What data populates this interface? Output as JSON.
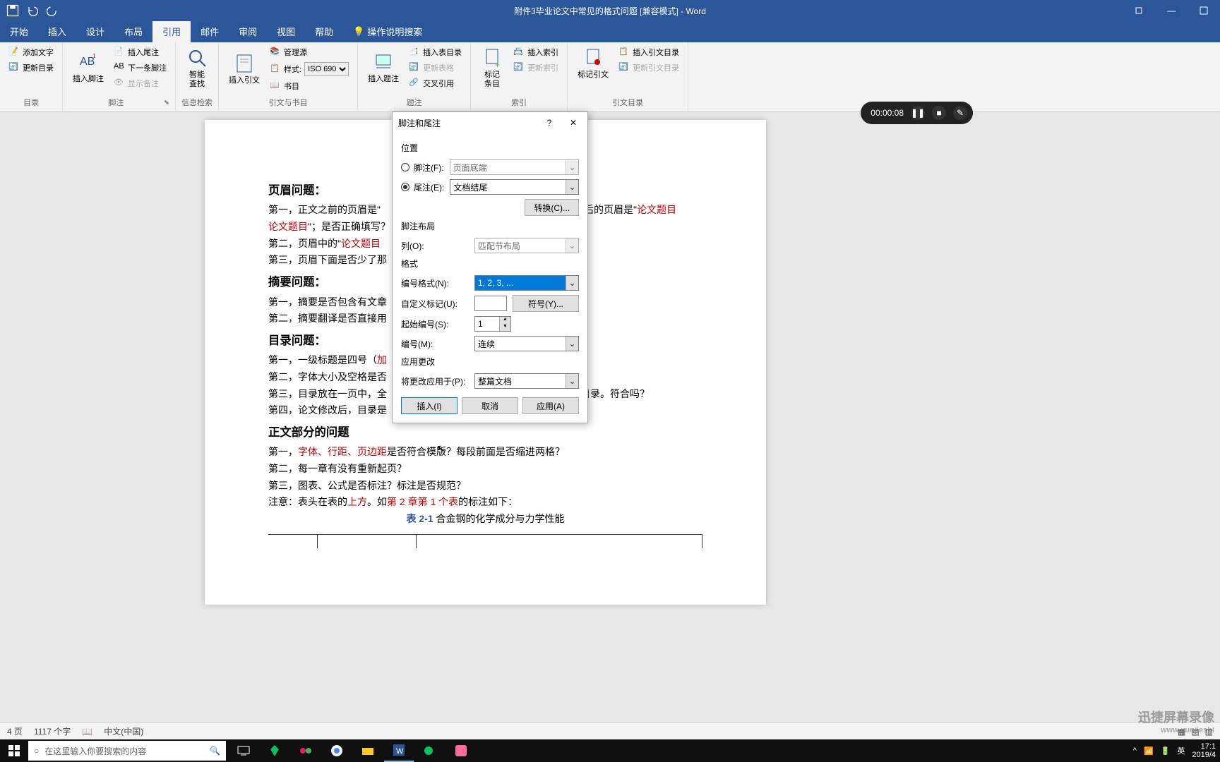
{
  "titlebar": {
    "title": "附件3毕业论文中常见的格式问题 [兼容模式] - Word"
  },
  "tabs": {
    "start": "开始",
    "insert": "插入",
    "design": "设计",
    "layout": "布局",
    "references": "引用",
    "mailings": "邮件",
    "review": "审阅",
    "view": "视图",
    "help": "帮助",
    "search": "操作说明搜索"
  },
  "ribbon": {
    "toc": {
      "add_text": "添加文字",
      "update_toc": "更新目录",
      "label": "目录"
    },
    "footnotes": {
      "insert_footnote": "插入脚注",
      "insert_endnote": "插入尾注",
      "next_footnote": "下一条脚注",
      "show_notes": "显示备注",
      "label": "脚注"
    },
    "research": {
      "smart_lookup": "智能\n查找",
      "label": "信息检索"
    },
    "citations": {
      "insert_citation": "插入引文",
      "manage_sources": "管理源",
      "style": "样式:",
      "style_value": "ISO 690",
      "bibliography": "书目",
      "label": "引文与书目"
    },
    "captions": {
      "insert_caption": "插入题注",
      "insert_tof": "插入表目录",
      "update_table": "更新表格",
      "cross_ref": "交叉引用",
      "label": "题注"
    },
    "index": {
      "mark_entry": "标记\n条目",
      "insert_index": "插入索引",
      "update_index": "更新索引",
      "label": "索引"
    },
    "toa": {
      "mark_citation": "标记引文",
      "insert_toa": "插入引文目录",
      "update_toa": "更新引文目录",
      "label": "引文目录"
    }
  },
  "dialog": {
    "title": "脚注和尾注",
    "sec_location": "位置",
    "footnote": "脚注(F):",
    "footnote_pos": "页面底端",
    "endnote": "尾注(E):",
    "endnote_pos": "文档结尾",
    "convert": "转换(C)...",
    "sec_layout": "脚注布局",
    "columns": "列(O):",
    "columns_val": "匹配节布局",
    "sec_format": "格式",
    "number_format": "编号格式(N):",
    "number_format_val": "1, 2, 3, ...",
    "custom_mark": "自定义标记(U):",
    "symbol": "符号(Y)...",
    "start_at": "起始编号(S):",
    "start_at_val": "1",
    "numbering": "编号(M):",
    "numbering_val": "连续",
    "sec_apply": "应用更改",
    "apply_to": "将更改应用于(P):",
    "apply_to_val": "整篇文档",
    "btn_insert": "插入(I)",
    "btn_cancel": "取消",
    "btn_apply": "应用(A)"
  },
  "doc": {
    "h1": "页眉问题：",
    "p1a": "第一，正文之前的页眉是\"",
    "p1b": "文之后的页眉是\"",
    "p1c": "论文题目",
    "p1d": "\"；是否正确填写？",
    "p2a": "第二，页眉中的\"",
    "p2b": "论文题目",
    "p3": "第三，页眉下面是否少了那",
    "h2": "摘要问题：",
    "p4": "第一，摘要是否包含有文章",
    "p5": "第二，摘要翻译是否直接用",
    "h3": "目录问题：",
    "p6a": "第一，一级标题是四号（",
    "p6b": "加",
    "p7": "第二，字体大小及空格是否",
    "p8a": "第三，目录放在一页中，全",
    "p8b": "级目录。符合吗？",
    "p9": "第四，论文修改后，目录是",
    "h4": "正文部分的问题",
    "p10a": "第一，",
    "p10b": "字体、行距、页边距",
    "p10c": "是否符合模版？每段前面是否缩进两格？",
    "p11": "第二，每一章有没有重新起页？",
    "p12": "第三，图表、公式是否标注？标注是否规范？",
    "p13a": "注意：表头在表的",
    "p13b": "上方",
    "p13c": "。如",
    "p13d": "第 2 章第 1 个表",
    "p13e": "的标注如下：",
    "table_caption_a": "表 2-1",
    "table_caption_b": " 合金钢的化学成分与力学性能"
  },
  "statusbar": {
    "page": "4 页",
    "words": "1117 个字",
    "lang": "中文(中国)"
  },
  "taskbar": {
    "search_placeholder": "在这里输入你要搜索的内容",
    "time": "17:1",
    "date": "2019/4",
    "ime": "英"
  },
  "recorder": {
    "time": "00:00:08"
  },
  "watermark": {
    "main": "迅捷屏幕录像",
    "sub": "www.xunjieshi"
  }
}
